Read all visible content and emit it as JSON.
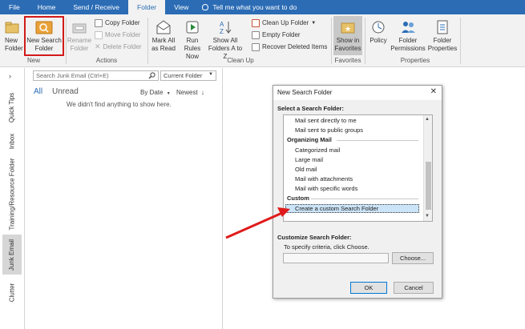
{
  "menu": {
    "tabs": [
      "File",
      "Home",
      "Send / Receive",
      "Folder",
      "View"
    ],
    "active_tab": "Folder",
    "tell_me": "Tell me what you want to do"
  },
  "ribbon": {
    "new_folder": "New Folder",
    "new_search_folder": "New Search Folder",
    "rename_folder": "Rename Folder",
    "copy_folder": "Copy Folder",
    "move_folder": "Move Folder",
    "delete_folder": "Delete Folder",
    "mark_all_read": "Mark All as Read",
    "run_rules_now": "Run Rules Now",
    "show_all_folders": "Show All Folders A to Z",
    "clean_up_folder": "Clean Up Folder",
    "empty_folder": "Empty Folder",
    "recover_deleted": "Recover Deleted Items",
    "show_in_favorites": "Show in Favorites",
    "policy": "Policy",
    "folder_permissions": "Folder Permissions",
    "folder_properties": "Folder Properties",
    "groups": {
      "new": "New",
      "actions": "Actions",
      "clean_up": "Clean Up",
      "favorites": "Favorites",
      "properties": "Properties"
    }
  },
  "nav": {
    "items": [
      "Quick Tips",
      "Inbox",
      "Training/Resource Folder",
      "Junk Email",
      "Clutter"
    ],
    "active": "Junk Email"
  },
  "folder_pane": {
    "search_placeholder": "Search Junk Email (Ctrl+E)",
    "scope": "Current Folder",
    "filter_all": "All",
    "filter_unread": "Unread",
    "sort_by": "By Date",
    "sort_order": "Newest",
    "empty_message": "We didn't find anything to show here."
  },
  "dialog": {
    "title": "New Search Folder",
    "select_label": "Select a Search Folder:",
    "list_items": [
      {
        "text": "Mail sent directly to me",
        "kind": "item"
      },
      {
        "text": "Mail sent to public groups",
        "kind": "item"
      },
      {
        "text": "Organizing Mail",
        "kind": "header"
      },
      {
        "text": "Categorized mail",
        "kind": "item"
      },
      {
        "text": "Large mail",
        "kind": "item"
      },
      {
        "text": "Old mail",
        "kind": "item"
      },
      {
        "text": "Mail with attachments",
        "kind": "item"
      },
      {
        "text": "Mail with specific words",
        "kind": "item"
      },
      {
        "text": "Custom",
        "kind": "header"
      },
      {
        "text": "Create a custom Search Folder",
        "kind": "item",
        "selected": true
      }
    ],
    "customize_label": "Customize Search Folder:",
    "criteria_hint": "To specify criteria, click Choose.",
    "choose_button": "Choose...",
    "ok_button": "OK",
    "cancel_button": "Cancel"
  },
  "colors": {
    "accent": "#2b6cb5",
    "highlight_box": "#d21a1a",
    "arrow": "#e01b1b",
    "selection": "#cce4f7"
  }
}
